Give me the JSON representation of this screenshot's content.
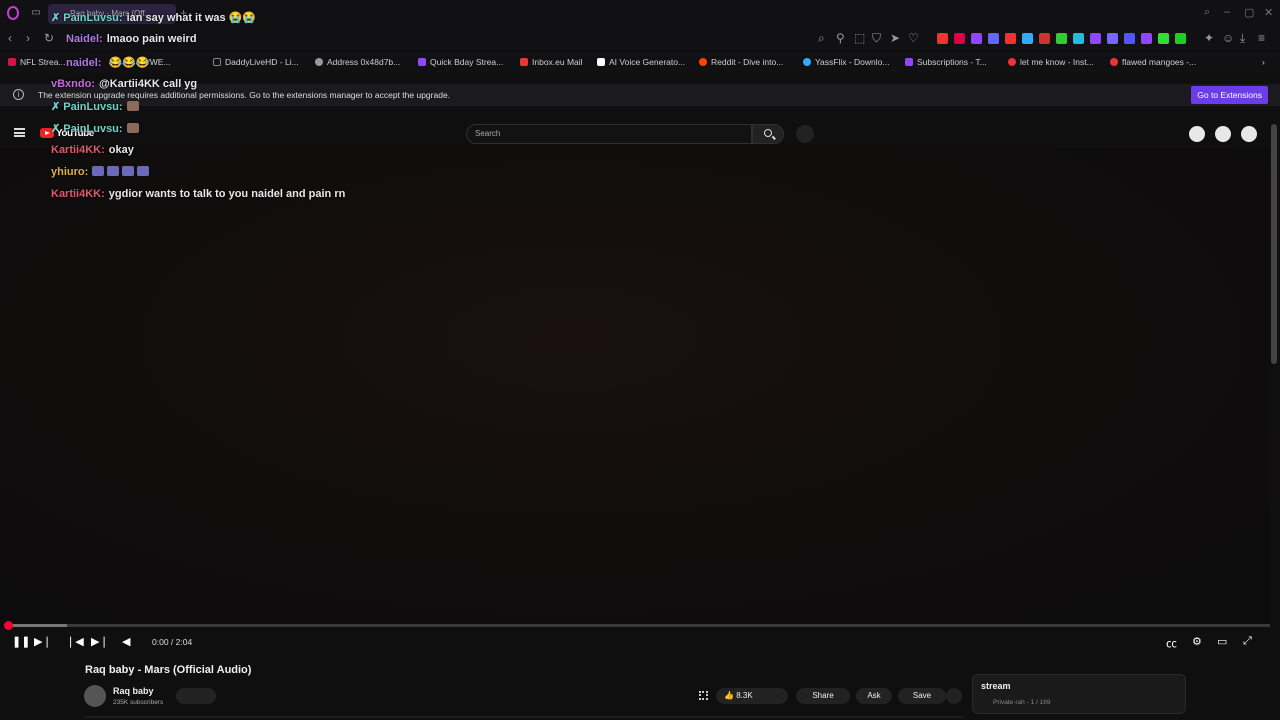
{
  "browser": {
    "active_tab_label": "Raq baby - Mars (Off...",
    "extension_notice": "The extension upgrade requires additional permissions. Go to the extensions manager to accept the upgrade.",
    "go_to_extensions_label": "Go to Extensions",
    "bookmarks": [
      {
        "label": "NFL Strea...",
        "icon_color": "#d14"
      },
      {
        "label": "w - WWE...",
        "icon_color": "#888"
      },
      {
        "label": "DaddyLiveHD - Li...",
        "icon_color": "#888"
      },
      {
        "label": "Address 0x48d7b...",
        "icon_color": "#999"
      },
      {
        "label": "Quick Bday Strea...",
        "icon_color": "#9146ff"
      },
      {
        "label": "Inbox.eu Mail",
        "icon_color": "#e33"
      },
      {
        "label": "AI Voice Generato...",
        "icon_color": "#fff"
      },
      {
        "label": "Reddit - Dive into...",
        "icon_color": "#ff4500"
      },
      {
        "label": "YassFlix - Downlo...",
        "icon_color": "#3af"
      },
      {
        "label": "Subscriptions - T...",
        "icon_color": "#9146ff"
      },
      {
        "label": "let me know - Inst...",
        "icon_color": "#e33"
      },
      {
        "label": "flawed mangoes -...",
        "icon_color": "#e33"
      }
    ]
  },
  "youtube": {
    "logo_text": "YouTube",
    "search_placeholder": "Search",
    "video_title": "Raq baby - Mars (Official Audio)",
    "channel_name": "Raq baby",
    "subscribers": "235K subscribers",
    "like_count": "8.3K",
    "share_label": "Share",
    "ask_label": "Ask",
    "save_label": "Save",
    "time_display": "0:00 / 2:04",
    "progress_fraction": 0.001,
    "buffered_fraction": 0.047,
    "playlist_title": "stream",
    "playlist_meta": "Private·rah - 1 / 169"
  },
  "chat": [
    {
      "user": "PainLuvsu:",
      "color": "#6fd3c8",
      "text": "ian say what it was",
      "emotes": [
        "😭",
        "😭"
      ],
      "badge": true
    },
    {
      "user": "Naidel:",
      "color": "#b07be0",
      "text": "lmaoo pain weird",
      "emotes": []
    },
    {
      "user": "naidel:",
      "color": "#b07be0",
      "text": "",
      "emotes": [
        "😂",
        "😂",
        "😂"
      ]
    },
    {
      "user": "vBxndo:",
      "color": "#c46ad9",
      "text": "@Kartii4KK call yg",
      "emotes": []
    },
    {
      "user": "PainLuvsu:",
      "color": "#6fd3c8",
      "text": "",
      "emotes": [
        "img"
      ],
      "badge": true
    },
    {
      "user": "PainLuvsu:",
      "color": "#6fd3c8",
      "text": "",
      "emotes": [
        "img"
      ],
      "badge": true
    },
    {
      "user": "Kartii4KK:",
      "color": "#e05a6e",
      "text": "okay",
      "emotes": []
    },
    {
      "user": "yhiuro:",
      "color": "#e0b040",
      "text": "",
      "emotes": [
        "img",
        "img",
        "img",
        "img"
      ]
    },
    {
      "user": "Kartii4KK:",
      "color": "#e05a6e",
      "text": "ygdior wants to talk to you naidel and pain rn",
      "emotes": []
    }
  ]
}
